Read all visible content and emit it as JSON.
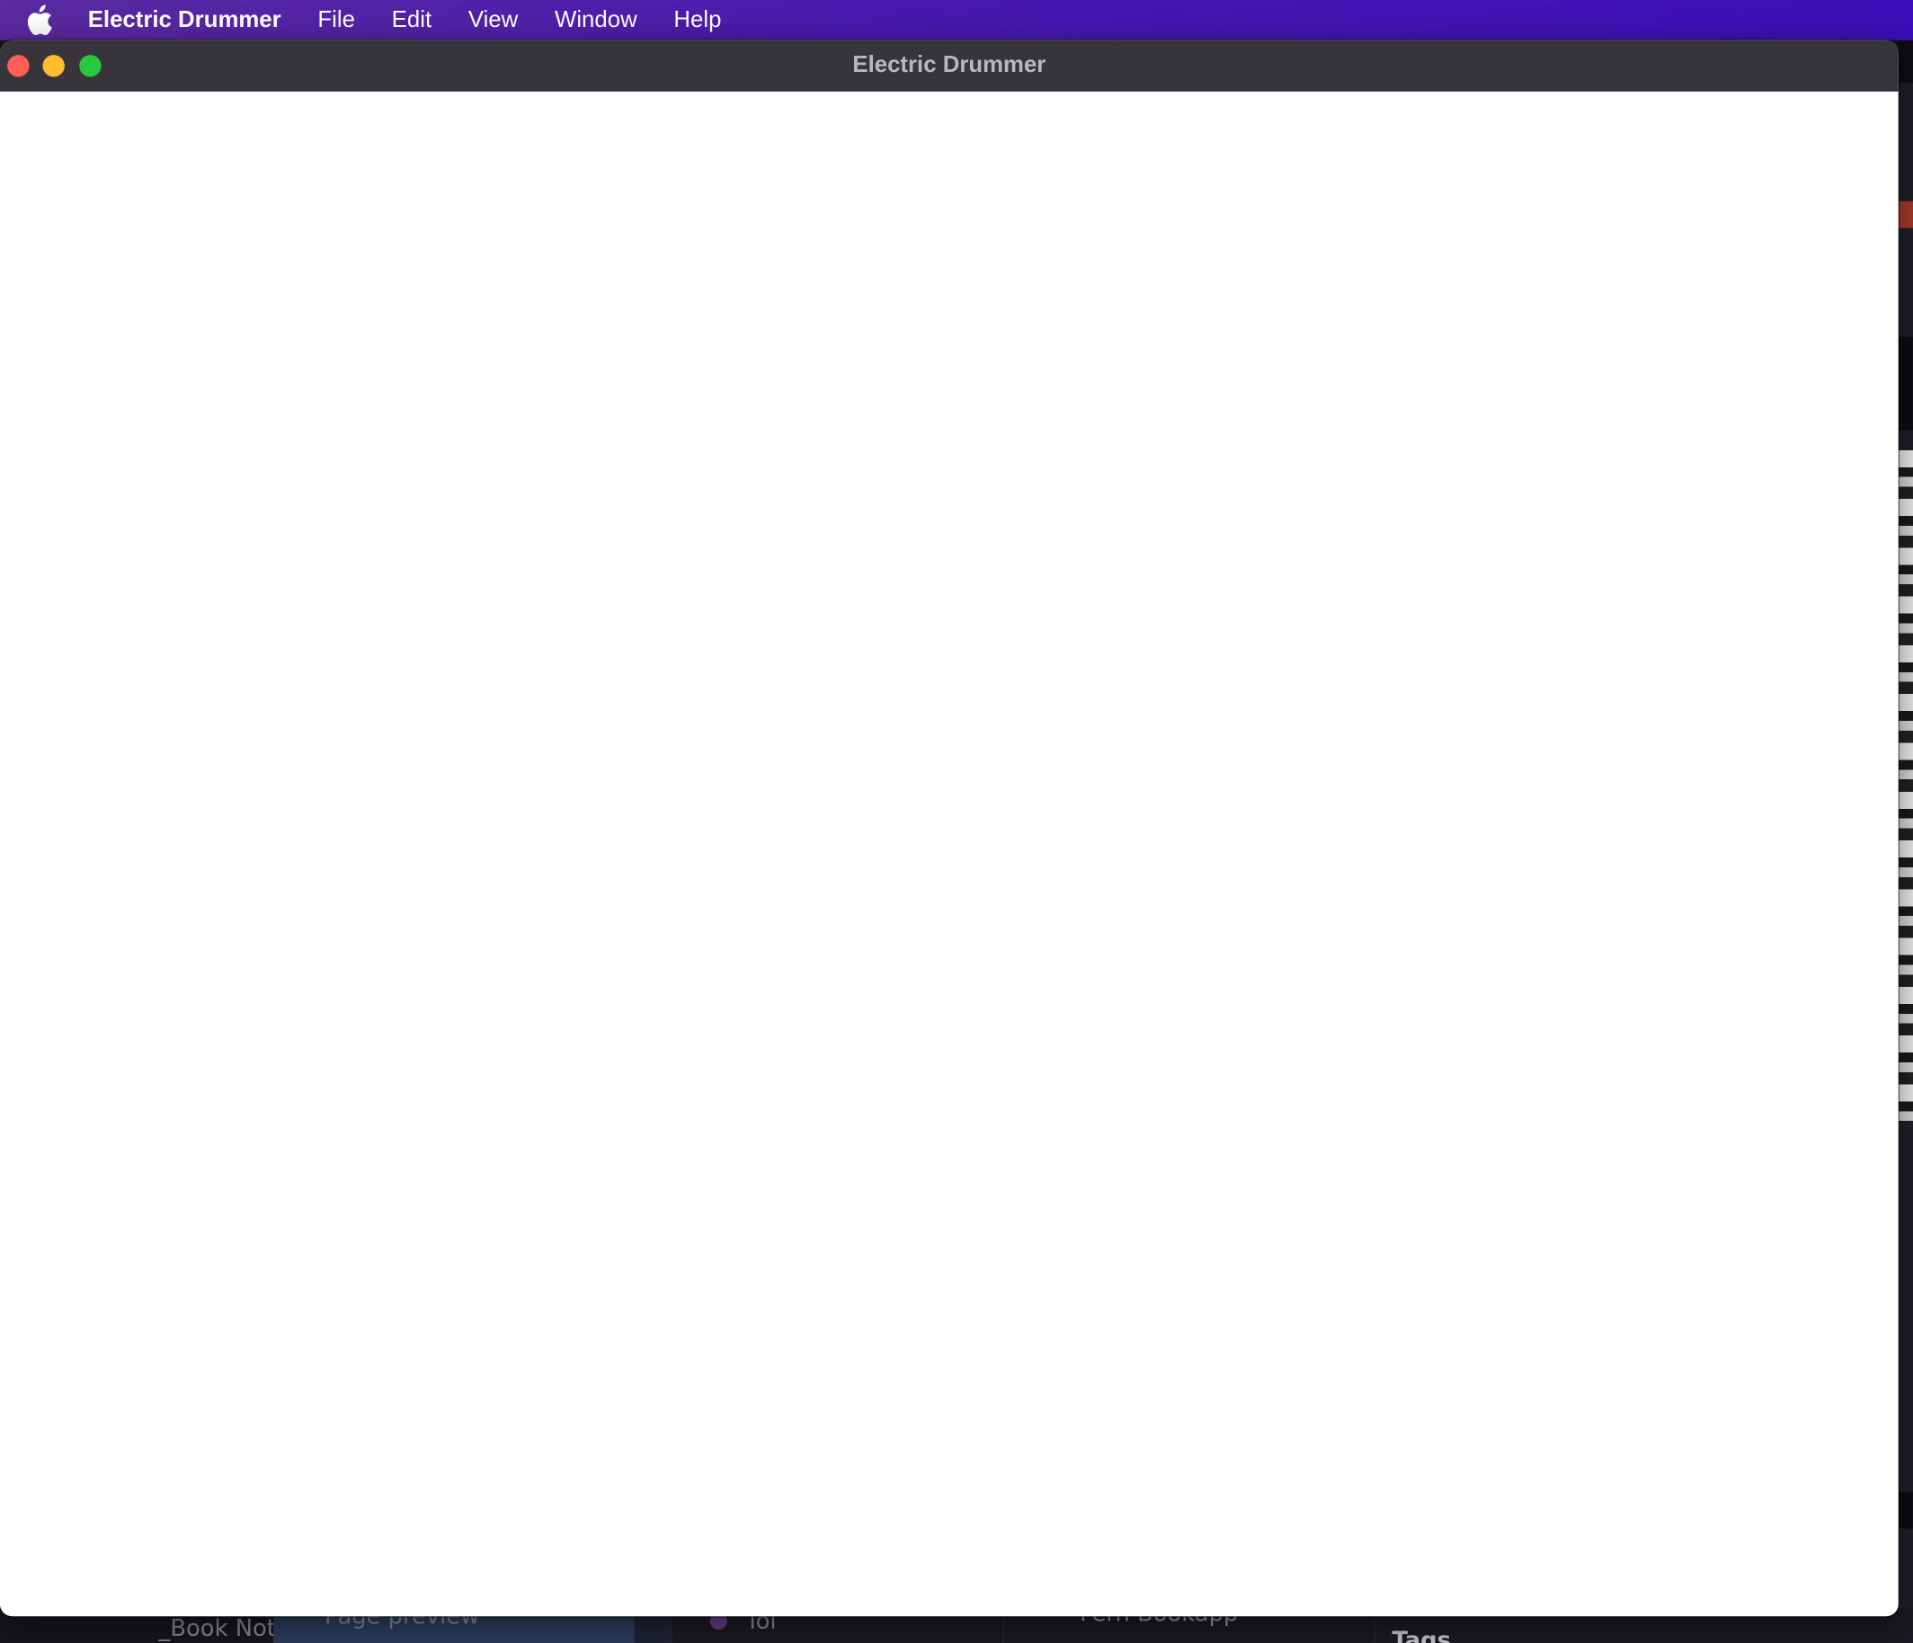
{
  "menubar": {
    "app_name": "Electric Drummer",
    "items": [
      "File",
      "Edit",
      "View",
      "Window",
      "Help"
    ],
    "gradient": [
      "#5a2aa0",
      "#3a10b8"
    ],
    "apple_icon": "apple-logo-icon"
  },
  "window": {
    "title": "Electric Drummer",
    "traffic_lights": {
      "close_color": "#fe5f57",
      "minimize_color": "#febc2e",
      "zoom_color": "#28c840"
    },
    "titlebar_color": "#37353b",
    "content_color": "#ffffff"
  },
  "background_apps": {
    "bottom_texts": [
      "_Book Note",
      "Page preview",
      "Tol",
      "Fern Bookapp",
      "Tags"
    ]
  }
}
